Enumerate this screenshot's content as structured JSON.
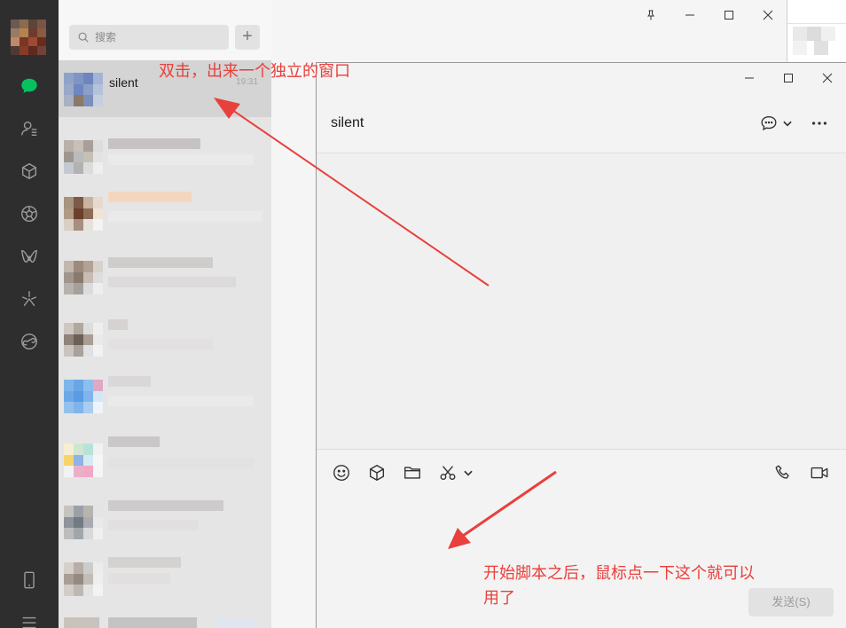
{
  "search": {
    "placeholder": "搜索",
    "add_label": "+"
  },
  "chat_list": {
    "selected": {
      "name": "silent",
      "time": "19:31"
    }
  },
  "chat_window": {
    "title": "silent",
    "send_label": "发送(S)"
  },
  "annotations": {
    "top": "双击，出来一个独立的窗口",
    "bottom_line1": "开始脚本之后，鼠标点一下这个就可以",
    "bottom_line2": "用了"
  },
  "icons": {
    "sidebar": [
      "chat-icon",
      "contacts-icon",
      "favorites-icon",
      "moments-icon",
      "channels-icon",
      "top-stories-icon",
      "mini-programs-icon",
      "phone-icon",
      "menu-icon"
    ],
    "chat_toolbar": [
      "emoji-icon",
      "favorites-icon",
      "folder-icon",
      "scissors-icon",
      "chevron-down-icon",
      "phone-call-icon",
      "video-call-icon"
    ]
  },
  "colors": {
    "accent": "#07c160",
    "annotation": "#e8403c",
    "sidebar": "#2e2e2e"
  }
}
